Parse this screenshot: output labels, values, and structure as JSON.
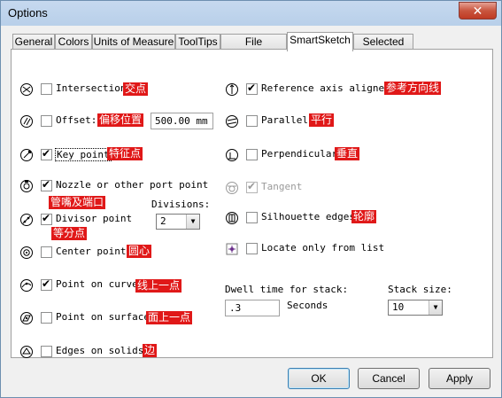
{
  "window": {
    "title": "Options",
    "close_glyph": "✕"
  },
  "tabs": [
    "General",
    "Colors",
    "Units of Measure",
    "ToolTips",
    "File Locations",
    "SmartSketch",
    "Selected PG"
  ],
  "active_tab": "SmartSketch",
  "left": {
    "intersection": {
      "label": "Intersection",
      "checked": false,
      "annotation": "交点",
      "icon": "intersection-icon"
    },
    "offset": {
      "label": "Offset:",
      "checked": false,
      "annotation": "偏移位置",
      "value": "500.00 mm",
      "icon": "offset-icon"
    },
    "key_point": {
      "label": "Key point",
      "checked": true,
      "annotation": "特征点",
      "icon": "key-point-icon"
    },
    "nozzle": {
      "label": "Nozzle or other port point",
      "checked": true,
      "annotation": "管嘴及端口",
      "icon": "nozzle-icon"
    },
    "divisor": {
      "label": "Divisor point",
      "checked": true,
      "annotation": "等分点",
      "divisions_label": "Divisions:",
      "divisions_value": "2",
      "icon": "divisor-icon"
    },
    "center": {
      "label": "Center point",
      "checked": false,
      "annotation": "圆心",
      "icon": "center-point-icon"
    },
    "point_on_curve": {
      "label": "Point on curve",
      "checked": true,
      "annotation": "线上一点",
      "icon": "point-on-curve-icon"
    },
    "point_on_surface": {
      "label": "Point on surface",
      "checked": false,
      "annotation": "面上一点",
      "icon": "point-on-surface-icon"
    },
    "edges": {
      "label": "Edges on solids",
      "checked": false,
      "annotation": "边",
      "icon": "edges-icon"
    }
  },
  "right": {
    "reference_axis": {
      "label": "Reference axis aligned",
      "checked": true,
      "annotation": "参考方向线",
      "icon": "reference-axis-icon"
    },
    "parallel": {
      "label": "Parallel",
      "checked": false,
      "annotation": "平行",
      "icon": "parallel-icon"
    },
    "perpendicular": {
      "label": "Perpendicular",
      "checked": false,
      "annotation": "垂直",
      "icon": "perpendicular-icon"
    },
    "tangent": {
      "label": "Tangent",
      "checked": true,
      "disabled": true,
      "icon": "tangent-icon"
    },
    "silhouette": {
      "label": "Silhouette edges",
      "checked": false,
      "annotation": "轮廓",
      "icon": "silhouette-icon"
    },
    "locate_only": {
      "label": "Locate only from list",
      "checked": false,
      "icon": "locate-list-icon"
    }
  },
  "dwell": {
    "label": "Dwell time for stack:",
    "value": ".3",
    "unit": "Seconds"
  },
  "stack": {
    "label": "Stack size:",
    "value": "10"
  },
  "buttons": {
    "ok": "OK",
    "cancel": "Cancel",
    "apply": "Apply"
  },
  "accent_colors": {
    "annotation": "#e01818",
    "close": "#c9563f"
  }
}
